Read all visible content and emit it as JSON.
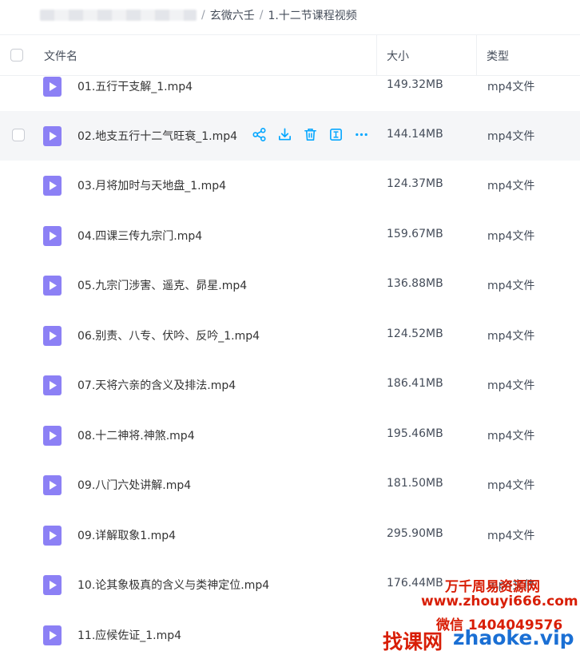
{
  "breadcrumb": {
    "items": [
      "玄微六壬",
      "1.十二节课程视频"
    ],
    "separator": "/"
  },
  "header": {
    "col_name": "文件名",
    "col_size": "大小",
    "col_type": "类型"
  },
  "files": [
    {
      "name": "01.五行干支解_1.mp4",
      "size": "149.32MB",
      "type": "mp4文件"
    },
    {
      "name": "02.地支五行十二气旺衰_1.mp4",
      "size": "144.14MB",
      "type": "mp4文件"
    },
    {
      "name": "03.月将加时与天地盘_1.mp4",
      "size": "124.37MB",
      "type": "mp4文件"
    },
    {
      "name": "04.四课三传九宗门.mp4",
      "size": "159.67MB",
      "type": "mp4文件"
    },
    {
      "name": "05.九宗门涉害、遥克、昴星.mp4",
      "size": "136.88MB",
      "type": "mp4文件"
    },
    {
      "name": "06.别责、八专、伏吟、反吟_1.mp4",
      "size": "124.52MB",
      "type": "mp4文件"
    },
    {
      "name": "07.天将六亲的含义及排法.mp4",
      "size": "186.41MB",
      "type": "mp4文件"
    },
    {
      "name": "08.十二神将.神煞.mp4",
      "size": "195.46MB",
      "type": "mp4文件"
    },
    {
      "name": "09.八门六处讲解.mp4",
      "size": "181.50MB",
      "type": "mp4文件"
    },
    {
      "name": "09.详解取象1.mp4",
      "size": "295.90MB",
      "type": "mp4文件"
    },
    {
      "name": "10.论其象极真的含义与类神定位.mp4",
      "size": "176.44MB",
      "type": "mp4文件"
    },
    {
      "name": "11.应候佐证_1.mp4",
      "size": "",
      "type": ""
    }
  ],
  "hovered_row_actions": [
    "share-icon",
    "download-icon",
    "delete-icon",
    "rename-icon",
    "more-icon"
  ],
  "colors": {
    "accent": "#06a7ff",
    "file_icon": "#8c80f5",
    "hover_bg": "#f5f6f8",
    "watermark_red": "#d81e06",
    "watermark_blue": "#1a6fd4"
  },
  "watermark": {
    "line1": "万千周易资源网",
    "line2": "www.zhouyi666.com",
    "line3": "微信 1404049576",
    "brand_cn": "找课网",
    "brand_en": "zhaoke.vip"
  }
}
